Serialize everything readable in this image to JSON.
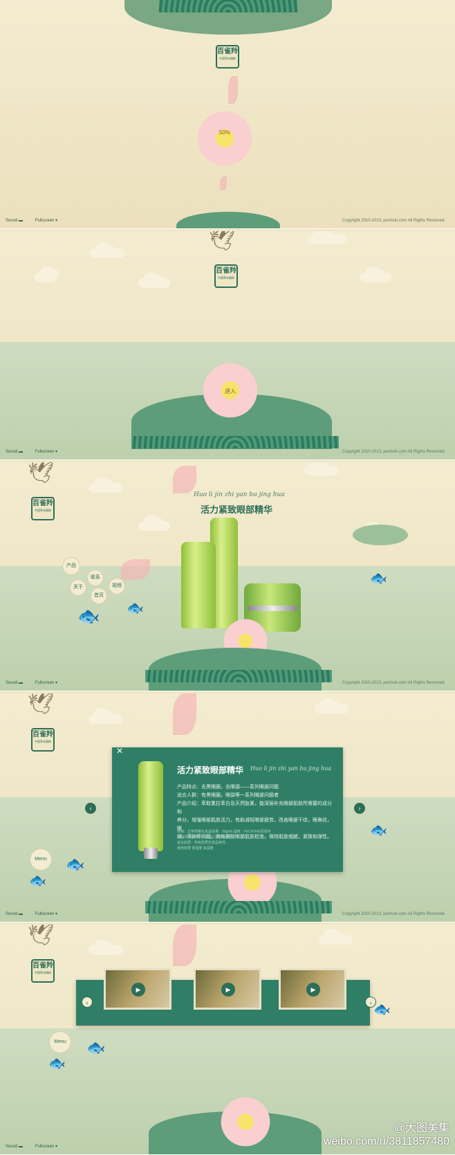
{
  "logo": {
    "line1": "百雀羚",
    "line2": "中国草本精粹"
  },
  "controls": {
    "sound": "Sound ▬",
    "fullscreen": "Fullscreen ▾"
  },
  "frame1": {
    "lotus_text": "50%",
    "copyright": "Copyright 2010-2013, pechoin.com All Rights Reserved."
  },
  "frame2": {
    "lotus_text": "进入",
    "copyright": "Copyright 2010-2013, pechoin.com All Rights Reserved."
  },
  "frame3": {
    "script_title": "Huo li jin zhi yan bu jing hua",
    "title": "活力紧致眼部精华",
    "menu": [
      "产品",
      "联系",
      "视频",
      "关于",
      "首页"
    ],
    "copyright": "Copyright 2010-2013, pechoin.com All Rights Reserved."
  },
  "frame4": {
    "title": "活力紧致眼部精华",
    "script_title": "Huo li jin zhi yan bu jing hua",
    "desc": [
      "产品特点：去黑眼圈，去眼袋——系列眼部问题",
      "适合人群：有黑眼圈，眼袋等一系列眼部问题者",
      "产品介绍：萃取重拉萃白及天然肽素，能深层补充眼部肌肤所需要的成分和",
      "养分，增强眼部肌肤活力，有助减轻眼部疲劳，改善眼部干纹，眼角纹，眼",
      "袋，浮肿等问题，有效预防眼部肌肤松弛，保持肌肤细腻，紧致和弹性。"
    ],
    "spec": [
      "规格：正常规格化妆品容量：30g/ml  品牌：PECHOIN/百雀羚",
      "面部护理单品：草本活力紧致眼部精华",
      "适合肤质：所有肤质化妆品特性：",
      "使用效果 保湿度 滋润度"
    ],
    "menu_label": "Menu",
    "copyright": "Copyright 2010-2013, pechoin.com All Rights Reserved."
  },
  "frame5": {
    "menu_label": "Menu"
  },
  "watermark": {
    "line1": "@大图美集",
    "line2": "weibo.com/u/3811857480"
  },
  "colors": {
    "accent": "#2d6e57",
    "lotus": "#f9cfcf",
    "background": "#efe6c6"
  }
}
